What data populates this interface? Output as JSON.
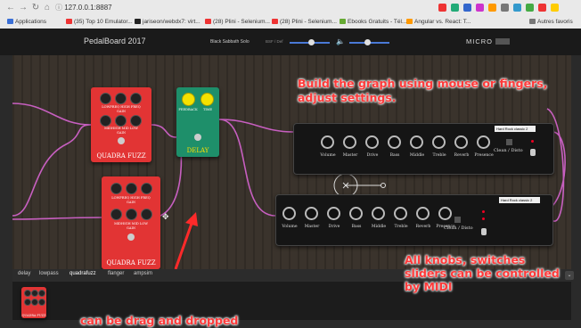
{
  "browser": {
    "url": "127.0.0.1:8887",
    "bookmarks": [
      {
        "label": "Applications",
        "color": "#3a6fd6"
      },
      {
        "label": "(35) Top 10 Emulator...",
        "color": "#e33"
      },
      {
        "label": "jariseon/webdx7: virt...",
        "color": "#222"
      },
      {
        "label": "(28) Plini - Selenium...",
        "color": "#e33"
      },
      {
        "label": "(28) Plini - Selenium...",
        "color": "#e33"
      },
      {
        "label": "Ebooks Gratuits - Tél...",
        "color": "#6a3"
      },
      {
        "label": "Angular vs. React: T...",
        "color": "#f90"
      },
      {
        "label": "Autres favoris",
        "color": "#777"
      }
    ],
    "ext_colors": [
      "#e33",
      "#2a7",
      "#36c",
      "#c3c",
      "#f90",
      "#777",
      "#39c",
      "#4a4",
      "#e33",
      "#fc0"
    ]
  },
  "app": {
    "title": "PedalBoard 2017",
    "preset_name": "Black Sabbath Solo",
    "preset_sub": "BSF / Def",
    "logo": "MICRO",
    "volume_level": 0.55,
    "midi_level": 0.45
  },
  "pedals": {
    "quadra_top": {
      "name": "QUADRA FUZZ",
      "labels": [
        "LOWFREQ HIGH FREQ",
        "GAIN",
        "MIDHIGH MID LOW",
        "GAIN"
      ]
    },
    "delay": {
      "name": "DELAY",
      "knob_labels": [
        "FEEDBACK",
        "TIME"
      ]
    },
    "quadra_bottom": {
      "name": "QUADRA FUZZ",
      "labels": [
        "LOWFREQ HIGH FREQ",
        "GAIN",
        "MIDHIGH MID LOW",
        "GAIN"
      ]
    }
  },
  "amps": {
    "top": {
      "preset": "Hard Rock classic 2",
      "knobs": [
        "Volume",
        "Master",
        "Drive",
        "Bass",
        "Middle",
        "Treble",
        "Reverb",
        "Presence"
      ],
      "switch_label": "Clean / Disto"
    },
    "bottom": {
      "preset": "Hard Rock classic 2",
      "knobs": [
        "Volume",
        "Master",
        "Drive",
        "Bass",
        "Middle",
        "Treble",
        "Reverb",
        "Presence"
      ],
      "switch_label": "Clean / Disto"
    }
  },
  "annotations": {
    "top": "Build the graph using mouse or fingers, adjust settings.",
    "drag": "can be drag and dropped",
    "midi": "All knobs, switches sliders can be controlled by MIDI"
  },
  "tray": {
    "tabs": [
      "delay",
      "lowpass",
      "quadrafuzz",
      "flanger",
      "ampsim"
    ],
    "active_tab": "quadrafuzz",
    "preview_name": "QUADRA FUZZ"
  },
  "colors": {
    "annotation": "#ff3a3a",
    "wire": "#c75fc0",
    "fuzz_pedal": "#e23434",
    "delay_pedal": "#1e8f6a",
    "accent": "#4a79d6"
  }
}
